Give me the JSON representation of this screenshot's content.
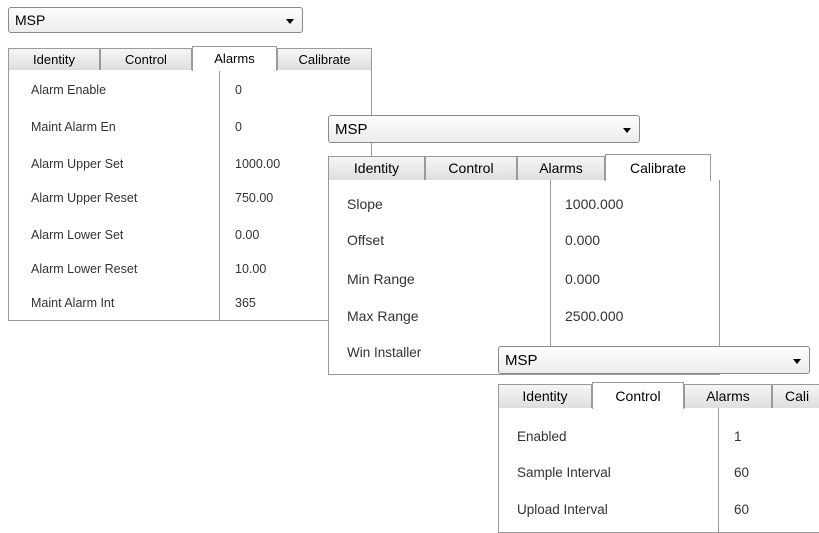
{
  "panel1": {
    "select": "MSP",
    "tabs": [
      "Identity",
      "Control",
      "Alarms",
      "Calibrate"
    ],
    "active_tab": "Alarms",
    "rows": [
      {
        "label": "Alarm Enable",
        "value": "0"
      },
      {
        "label": "Maint Alarm En",
        "value": "0"
      },
      {
        "label": "Alarm Upper Set",
        "value": "1000.00"
      },
      {
        "label": "Alarm Upper Reset",
        "value": "750.00"
      },
      {
        "label": "Alarm Lower Set",
        "value": "0.00"
      },
      {
        "label": "Alarm Lower Reset",
        "value": "10.00"
      },
      {
        "label": "Maint Alarm Int",
        "value": "365"
      }
    ]
  },
  "panel2": {
    "select": "MSP",
    "tabs": [
      "Identity",
      "Control",
      "Alarms",
      "Calibrate"
    ],
    "active_tab": "Calibrate",
    "rows": [
      {
        "label": "Slope",
        "value": "1000.000"
      },
      {
        "label": "Offset",
        "value": "0.000"
      },
      {
        "label": "Min Range",
        "value": "0.000"
      },
      {
        "label": "Max Range",
        "value": "2500.000"
      },
      {
        "label": "Win Installer",
        "value": ""
      }
    ]
  },
  "panel3": {
    "select": "MSP",
    "tabs": [
      "Identity",
      "Control",
      "Alarms",
      "Cali"
    ],
    "active_tab": "Control",
    "rows": [
      {
        "label": "Enabled",
        "value": "1"
      },
      {
        "label": "Sample Interval",
        "value": "60"
      },
      {
        "label": "Upload Interval",
        "value": "60"
      }
    ]
  }
}
